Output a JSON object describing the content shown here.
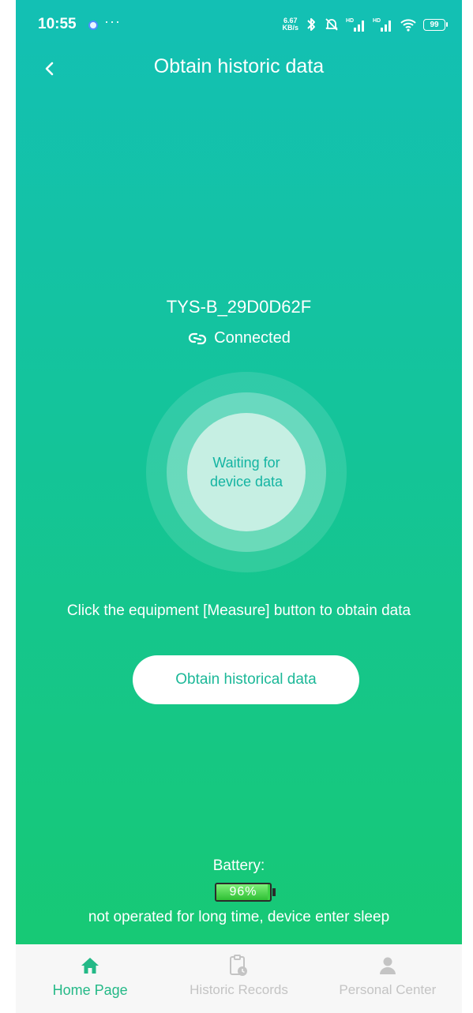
{
  "status_bar": {
    "time": "10:55",
    "more": "···",
    "net_speed_value": "6.67",
    "net_speed_unit": "KB/s",
    "battery": "99"
  },
  "header": {
    "title": "Obtain historic data"
  },
  "device": {
    "name": "TYS-B_29D0D62F",
    "connection_status": "Connected",
    "waiting_text": "Waiting for device data"
  },
  "instruction": "Click the equipment [Measure] button to obtain data",
  "obtain_button_label": "Obtain historical data",
  "battery": {
    "label": "Battery:",
    "level_text": "96%",
    "level_fraction": 0.96
  },
  "sleep_notice": "not operated for long time, device enter sleep",
  "tab_bar": {
    "tabs": [
      {
        "label": "Home Page",
        "icon": "home-icon",
        "active": true
      },
      {
        "label": "Historic Records",
        "icon": "clipboard-clock-icon",
        "active": false
      },
      {
        "label": "Personal Center",
        "icon": "person-icon",
        "active": false
      }
    ]
  },
  "colors": {
    "accent": "#24b987",
    "gradient_top": "#13c0b4",
    "gradient_bottom": "#17c975",
    "battery_green": "#3fd345"
  }
}
